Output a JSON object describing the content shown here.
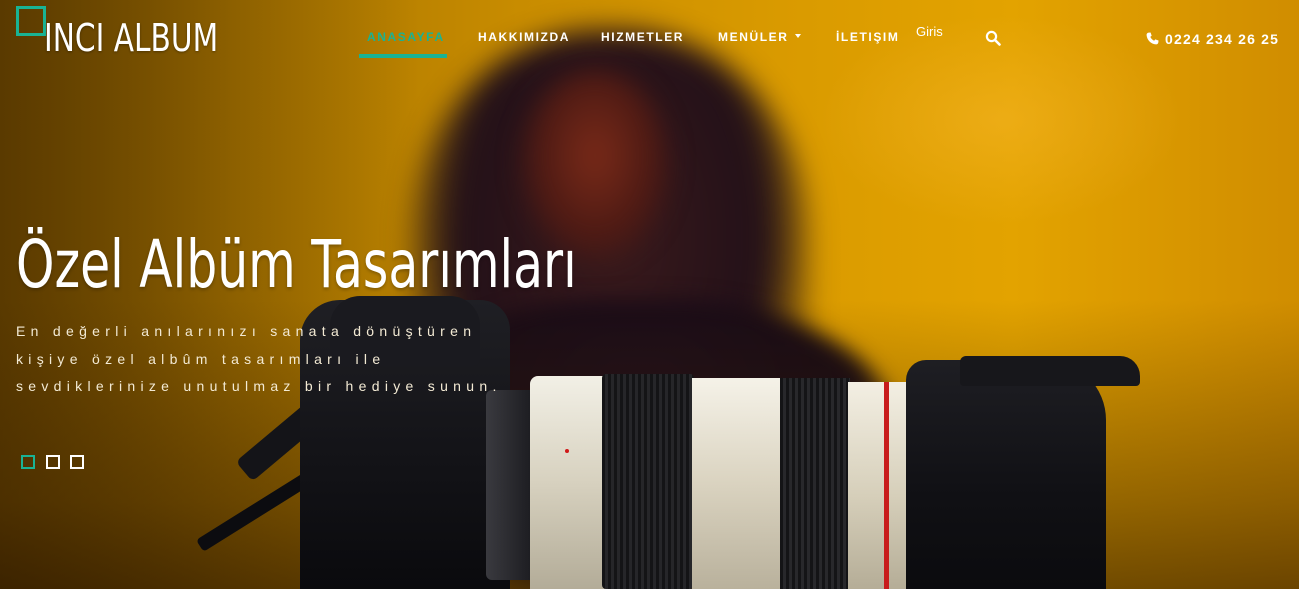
{
  "brand": {
    "name": "INCI ALBUM",
    "accent_color": "#19b394"
  },
  "nav": {
    "items": [
      {
        "label": "ANASAYFA",
        "active": true
      },
      {
        "label": "HAKKIMIZDA",
        "active": false
      },
      {
        "label": "HIZMETLER",
        "active": false
      },
      {
        "label": "MENÜLER",
        "active": false,
        "dropdown": true
      },
      {
        "label": "İLETIŞIM",
        "active": false
      }
    ],
    "login_label": "Giris",
    "search_icon": "search-icon"
  },
  "contact": {
    "phone": "0224 234 26 25",
    "phone_icon": "phone-icon"
  },
  "hero": {
    "title": "Özel Albüm Tasarımları",
    "description": "En değerli anılarınızı sanata dönüştüren kişiye özel albûm tasarımları ile sevdiklerinize unutulmaz bir hediye sunun.",
    "slides": [
      {
        "active": true
      },
      {
        "active": false
      },
      {
        "active": false
      }
    ]
  }
}
